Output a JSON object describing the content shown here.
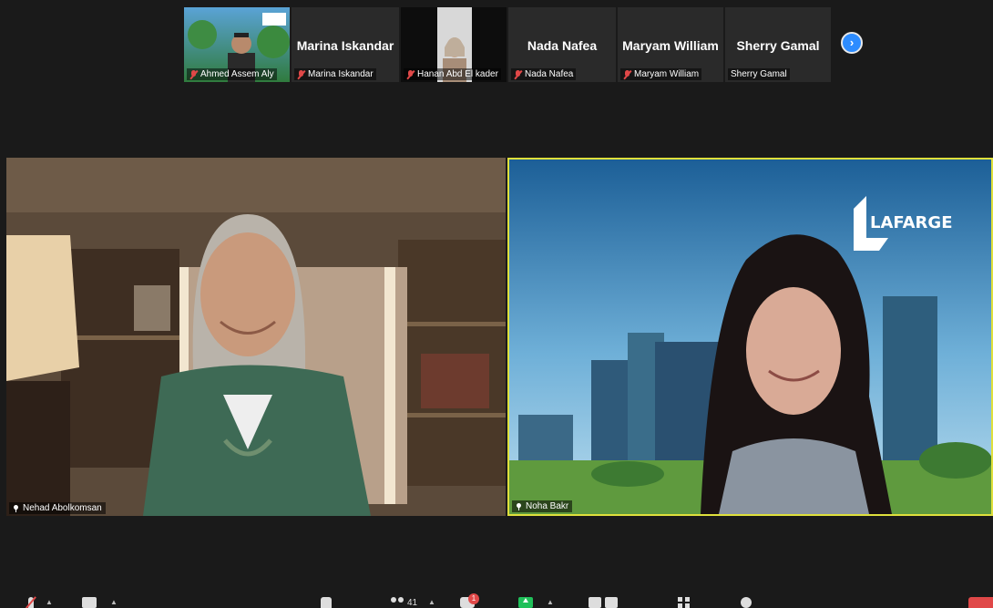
{
  "gallery": {
    "participants": [
      {
        "name": "Ahmed Assem Aly",
        "muted": true,
        "video": true
      },
      {
        "name": "Marina Iskandar",
        "display": "Marina Iskandar",
        "muted": true,
        "video": false
      },
      {
        "name": "Hanan Abd El kader",
        "muted": true,
        "video": true
      },
      {
        "name": "Nada Nafea",
        "display": "Nada Nafea",
        "muted": true,
        "video": false
      },
      {
        "name": "Maryam William",
        "display": "Maryam William",
        "muted": true,
        "video": false
      },
      {
        "name": "Sherry Gamal",
        "display": "Sherry Gamal",
        "muted": false,
        "video": false
      }
    ],
    "next_icon": "chevron-right-icon"
  },
  "main": {
    "left": {
      "name": "Nehad Abolkomsan",
      "pinned": true
    },
    "right": {
      "name": "Noha Bakr",
      "pinned": true,
      "active_speaker": true,
      "background_logo": "LAFARGE"
    }
  },
  "toolbar": {
    "participants_count": "41",
    "chat_badge": "1",
    "icons": [
      "mic-muted-icon",
      "video-icon",
      "security-icon",
      "participants-icon",
      "chat-icon",
      "share-screen-icon",
      "record-icon",
      "apps-icon",
      "reactions-icon",
      "end-icon"
    ]
  },
  "colors": {
    "active_speaker_border": "#dfe03c",
    "accent": "#2d8cff",
    "muted": "#e04848",
    "share": "#20c05a"
  }
}
